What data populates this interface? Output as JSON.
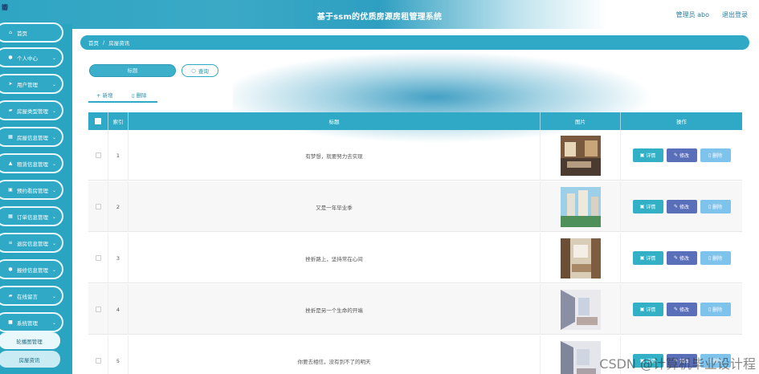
{
  "header": {
    "corner_mark": "瓣",
    "title": "基于ssm的优质房源房租管理系统",
    "user_label": "管理员 abo",
    "logout_label": "退出登录"
  },
  "sidebar": {
    "items": [
      {
        "label": "首页",
        "icon": "home-icon"
      },
      {
        "label": "个人中心",
        "icon": "user-icon"
      },
      {
        "label": "用户管理",
        "icon": "send-icon"
      },
      {
        "label": "房屋类型管理",
        "icon": "chat-icon"
      },
      {
        "label": "房屋信息管理",
        "icon": "grid-icon"
      },
      {
        "label": "租赁信息管理",
        "icon": "stamp-icon"
      },
      {
        "label": "预约看房管理",
        "icon": "calendar-icon"
      },
      {
        "label": "订单信息管理",
        "icon": "grid-icon"
      },
      {
        "label": "退房信息管理",
        "icon": "list-icon"
      },
      {
        "label": "报修信息管理",
        "icon": "user-icon"
      },
      {
        "label": "在线留言",
        "icon": "chat-icon"
      },
      {
        "label": "系统管理",
        "icon": "box-icon"
      }
    ],
    "sub_items": [
      {
        "label": "轮播图管理"
      },
      {
        "label": "房屋资讯"
      }
    ]
  },
  "breadcrumb": {
    "home": "首页",
    "separator": "/",
    "current": "房屋资讯"
  },
  "search": {
    "placeholder": "标题",
    "button_label": "查询"
  },
  "toolbar": {
    "add_label": "+ 新增",
    "delete_label": "删除"
  },
  "table": {
    "columns": [
      "索引",
      "标题",
      "图片",
      "操作"
    ],
    "rows": [
      {
        "index": "1",
        "title": "有梦想，就要努力去实现"
      },
      {
        "index": "2",
        "title": "又是一年毕业季"
      },
      {
        "index": "3",
        "title": "挫折路上，坚持常在心间"
      },
      {
        "index": "4",
        "title": "挫折是另一个生命的开端"
      },
      {
        "index": "5",
        "title": "你要去相信，没有到不了的明天"
      }
    ],
    "actions": {
      "detail": "详情",
      "edit": "修改",
      "delete": "删除"
    }
  },
  "watermark": "CSDN @计算机毕业设计程",
  "colors": {
    "primary": "#2fa9c5",
    "edit": "#5a6fb9",
    "delete": "#7dc3ec"
  }
}
